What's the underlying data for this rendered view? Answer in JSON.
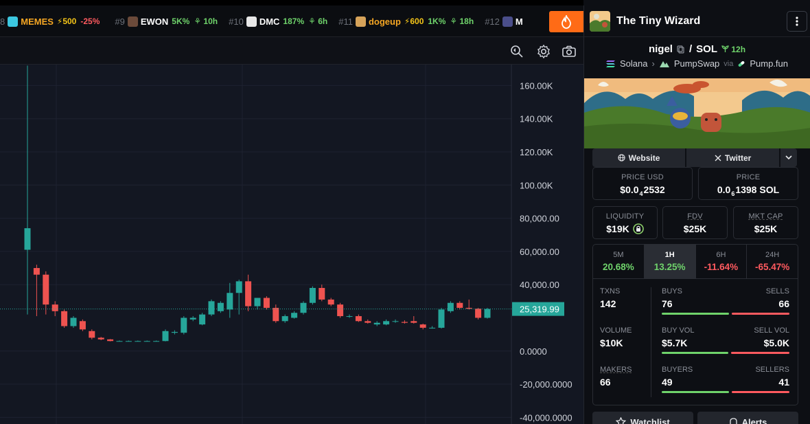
{
  "ticker": {
    "items": [
      {
        "rank": "8",
        "symbol": "MEMES",
        "boost": "⚡500",
        "pct": "-25%",
        "dir": "down",
        "age": "",
        "sym_color": "orange",
        "logo_color": "#3cc7e0"
      },
      {
        "rank": "#9",
        "symbol": "EWON",
        "boost": "",
        "pct": "5K%",
        "dir": "up",
        "age": "10h",
        "sym_color": "",
        "logo_color": "#6b4a3a"
      },
      {
        "rank": "#10",
        "symbol": "DMC",
        "boost": "",
        "pct": "187%",
        "dir": "up",
        "age": "6h",
        "sym_color": "",
        "logo_color": "#e7e7e7"
      },
      {
        "rank": "#11",
        "symbol": "dogeup",
        "boost": "⚡600",
        "pct": "1K%",
        "dir": "up",
        "age": "18h",
        "sym_color": "orange",
        "logo_color": "#d6a35a"
      },
      {
        "rank": "#12",
        "symbol": "M",
        "boost": "",
        "pct": "",
        "dir": "up",
        "age": "",
        "sym_color": "",
        "logo_color": "#4a4e8a"
      }
    ]
  },
  "chart": {
    "price_label": "25,319.99",
    "y_ticks": [
      "160.00K",
      "140.00K",
      "120.00K",
      "100.00K",
      "80,000.00",
      "60,000.00",
      "40,000.00",
      "0.0000",
      "-20,000.0000",
      "-40,000.0000"
    ],
    "colors": {
      "up": "#26a69a",
      "down": "#ef5350",
      "bg": "#131722",
      "grid": "#1e2230"
    }
  },
  "chart_data": {
    "type": "candlestick",
    "ylim": [
      -40000,
      170000
    ],
    "current_price": 25319.99,
    "candles": [
      {
        "o": 61000,
        "h": 172000,
        "l": 22000,
        "c": 74000
      },
      {
        "o": 50000,
        "h": 52000,
        "l": 21000,
        "c": 46000
      },
      {
        "o": 46000,
        "h": 48000,
        "l": 22000,
        "c": 28000
      },
      {
        "o": 28000,
        "h": 30000,
        "l": 21000,
        "c": 24000
      },
      {
        "o": 24000,
        "h": 25000,
        "l": 14000,
        "c": 15000
      },
      {
        "o": 15000,
        "h": 21000,
        "l": 14000,
        "c": 20000
      },
      {
        "o": 18000,
        "h": 19000,
        "l": 12000,
        "c": 13000
      },
      {
        "o": 12000,
        "h": 13000,
        "l": 7000,
        "c": 8000
      },
      {
        "o": 8000,
        "h": 8500,
        "l": 6500,
        "c": 7000
      },
      {
        "o": 7000,
        "h": 7200,
        "l": 5800,
        "c": 6000
      },
      {
        "o": 6000,
        "h": 6300,
        "l": 5800,
        "c": 6000
      },
      {
        "o": 6000,
        "h": 6300,
        "l": 5800,
        "c": 6000
      },
      {
        "o": 6000,
        "h": 6300,
        "l": 5800,
        "c": 6000
      },
      {
        "o": 6000,
        "h": 6300,
        "l": 5800,
        "c": 6000
      },
      {
        "o": 6000,
        "h": 6300,
        "l": 5800,
        "c": 6000
      },
      {
        "o": 6000,
        "h": 13000,
        "l": 5800,
        "c": 12000
      },
      {
        "o": 11000,
        "h": 12500,
        "l": 10000,
        "c": 11500
      },
      {
        "o": 11000,
        "h": 21000,
        "l": 10000,
        "c": 20000
      },
      {
        "o": 19000,
        "h": 21000,
        "l": 18000,
        "c": 20000
      },
      {
        "o": 16000,
        "h": 23000,
        "l": 15500,
        "c": 22000
      },
      {
        "o": 22000,
        "h": 31000,
        "l": 21000,
        "c": 30000
      },
      {
        "o": 24000,
        "h": 30000,
        "l": 23000,
        "c": 29000
      },
      {
        "o": 25000,
        "h": 41000,
        "l": 20000,
        "c": 35000
      },
      {
        "o": 35000,
        "h": 43000,
        "l": 22000,
        "c": 42000
      },
      {
        "o": 42000,
        "h": 46000,
        "l": 24000,
        "c": 27000
      },
      {
        "o": 27000,
        "h": 31000,
        "l": 25000,
        "c": 32000
      },
      {
        "o": 32000,
        "h": 33000,
        "l": 25000,
        "c": 26000
      },
      {
        "o": 26000,
        "h": 28000,
        "l": 17000,
        "c": 18000
      },
      {
        "o": 18000,
        "h": 22000,
        "l": 17000,
        "c": 21000
      },
      {
        "o": 20000,
        "h": 24000,
        "l": 19500,
        "c": 23000
      },
      {
        "o": 23000,
        "h": 30000,
        "l": 22000,
        "c": 29000
      },
      {
        "o": 29000,
        "h": 39000,
        "l": 28000,
        "c": 38000
      },
      {
        "o": 38000,
        "h": 40000,
        "l": 30000,
        "c": 31000
      },
      {
        "o": 31000,
        "h": 32000,
        "l": 27000,
        "c": 28000
      },
      {
        "o": 28000,
        "h": 29000,
        "l": 20000,
        "c": 21000
      },
      {
        "o": 21000,
        "h": 22000,
        "l": 20000,
        "c": 21000
      },
      {
        "o": 21000,
        "h": 22000,
        "l": 17500,
        "c": 18000
      },
      {
        "o": 18000,
        "h": 19000,
        "l": 16500,
        "c": 17000
      },
      {
        "o": 16000,
        "h": 18000,
        "l": 15000,
        "c": 17000
      },
      {
        "o": 16000,
        "h": 19000,
        "l": 15500,
        "c": 18000
      },
      {
        "o": 18000,
        "h": 19000,
        "l": 17000,
        "c": 18000
      },
      {
        "o": 17500,
        "h": 18500,
        "l": 16500,
        "c": 17000
      },
      {
        "o": 18000,
        "h": 21000,
        "l": 16500,
        "c": 17000
      },
      {
        "o": 16000,
        "h": 16500,
        "l": 13000,
        "c": 14000
      },
      {
        "o": 14000,
        "h": 15000,
        "l": 13500,
        "c": 14000
      },
      {
        "o": 14000,
        "h": 26000,
        "l": 13500,
        "c": 25000
      },
      {
        "o": 24000,
        "h": 30000,
        "l": 23000,
        "c": 29000
      },
      {
        "o": 29000,
        "h": 30000,
        "l": 25000,
        "c": 26000
      },
      {
        "o": 26000,
        "h": 31000,
        "l": 25000,
        "c": 25500
      },
      {
        "o": 25500,
        "h": 26000,
        "l": 19000,
        "c": 20000
      },
      {
        "o": 20000,
        "h": 26000,
        "l": 19500,
        "c": 25320
      }
    ]
  },
  "panel": {
    "title": "The Tiny Wizard",
    "base": "nigel",
    "sep": "/",
    "quote": "SOL",
    "age": "12h",
    "chain": "Solana",
    "dex": "PumpSwap",
    "via": "via",
    "launchpad": "Pump.fun",
    "website_label": "Website",
    "twitter_label": "Twitter",
    "price_usd_label": "PRICE USD",
    "price_usd_a": "$0.0",
    "price_usd_sub": "4",
    "price_usd_b": "2532",
    "price_label": "PRICE",
    "price_a": "0.0",
    "price_sub": "6",
    "price_b": "1398 SOL",
    "liquidity_label": "LIQUIDITY",
    "liquidity_value": "$19K",
    "fdv_label": "FDV",
    "fdv_value": "$25K",
    "mcap_label": "MKT CAP",
    "mcap_value": "$25K",
    "timeframes": [
      {
        "label": "5M",
        "value": "20.68%",
        "dir": "up"
      },
      {
        "label": "1H",
        "value": "13.25%",
        "dir": "up"
      },
      {
        "label": "6H",
        "value": "-11.64%",
        "dir": "down"
      },
      {
        "label": "24H",
        "value": "-65.47%",
        "dir": "down"
      }
    ],
    "stats": {
      "txns_label": "TXNS",
      "txns_value": "142",
      "buys_label": "BUYS",
      "buys_value": "76",
      "sells_label": "SELLS",
      "sells_value": "66",
      "volume_label": "VOLUME",
      "volume_value": "$10K",
      "buyvol_label": "BUY VOL",
      "buyvol_value": "$5.7K",
      "sellvol_label": "SELL VOL",
      "sellvol_value": "$5.0K",
      "makers_label": "MAKERS",
      "makers_value": "66",
      "buyers_label": "BUYERS",
      "buyers_value": "49",
      "sellers_label": "SELLERS",
      "sellers_value": "41"
    },
    "watchlist_label": "Watchlist",
    "alerts_label": "Alerts"
  }
}
